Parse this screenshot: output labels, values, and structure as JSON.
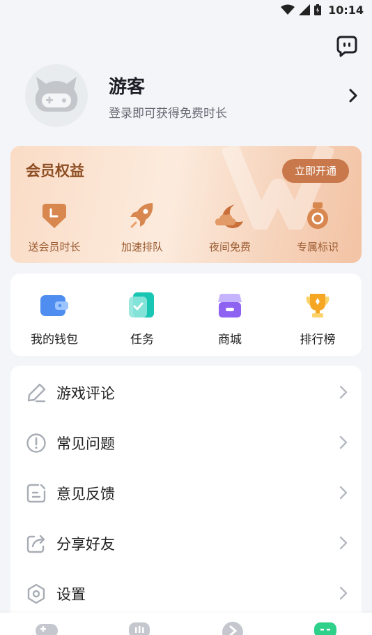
{
  "status_bar": {
    "time": "10:14"
  },
  "profile": {
    "name": "游客",
    "subtitle": "登录即可获得免费时长"
  },
  "vip": {
    "title": "会员权益",
    "open_button": "立即开通",
    "items": [
      {
        "label": "送会员时长",
        "icon": "clock-tag-icon"
      },
      {
        "label": "加速排队",
        "icon": "rocket-icon"
      },
      {
        "label": "夜间免费",
        "icon": "moon-cloud-icon"
      },
      {
        "label": "专属标识",
        "icon": "medal-icon"
      }
    ]
  },
  "quick": {
    "items": [
      {
        "label": "我的钱包",
        "icon": "wallet-icon"
      },
      {
        "label": "任务",
        "icon": "task-icon"
      },
      {
        "label": "商城",
        "icon": "store-icon"
      },
      {
        "label": "排行榜",
        "icon": "trophy-icon"
      }
    ]
  },
  "menu": {
    "items": [
      {
        "label": "游戏评论",
        "icon": "pencil-icon"
      },
      {
        "label": "常见问题",
        "icon": "alert-circle-icon"
      },
      {
        "label": "意见反馈",
        "icon": "feedback-icon"
      },
      {
        "label": "分享好友",
        "icon": "share-icon"
      },
      {
        "label": "设置",
        "icon": "settings-icon"
      }
    ]
  },
  "colors": {
    "vip_text": "#8e4e24",
    "vip_button": "#c8784a",
    "accent_green": "#2fd08a"
  }
}
